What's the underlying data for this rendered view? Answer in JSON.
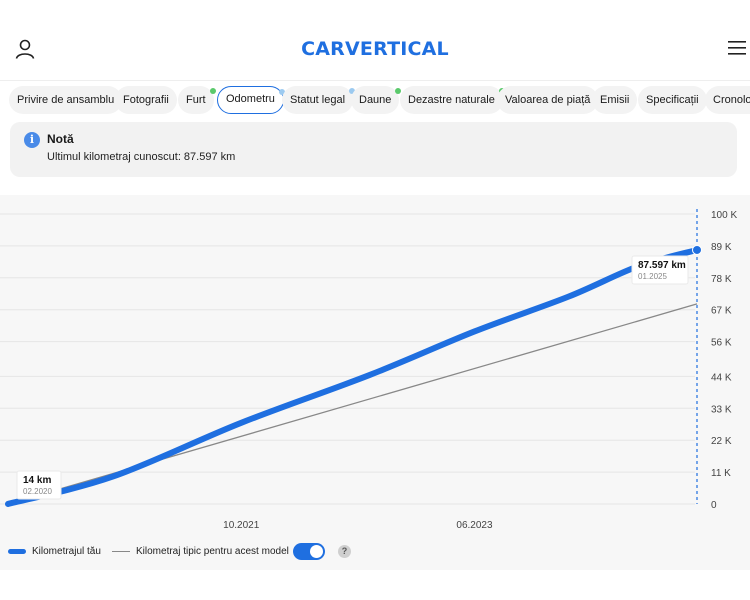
{
  "header": {
    "logo_text": "CARVERTICAL",
    "user_icon": "user-icon",
    "menu_icon": "hamburger-menu-icon"
  },
  "tabs": [
    {
      "label": "Privire de ansamblu",
      "active": false,
      "dot": null
    },
    {
      "label": "Fotografii",
      "active": false,
      "dot": null
    },
    {
      "label": "Furt",
      "active": false,
      "dot": "#5ac96b"
    },
    {
      "label": "Odometru",
      "active": true,
      "dot": "#9ccaf0"
    },
    {
      "label": "Statut legal",
      "active": false,
      "dot": "#9ccaf0"
    },
    {
      "label": "Daune",
      "active": false,
      "dot": "#5ac96b"
    },
    {
      "label": "Dezastre naturale",
      "active": false,
      "dot": "#5ac96b"
    },
    {
      "label": "Valoarea de piață",
      "active": false,
      "dot": null
    },
    {
      "label": "Emisii",
      "active": false,
      "dot": null
    },
    {
      "label": "Specificații",
      "active": false,
      "dot": null
    },
    {
      "label": "Cronologie",
      "active": false,
      "dot": null
    }
  ],
  "note": {
    "title": "Notă",
    "text": "Ultimul kilometraj cunoscut: 87.597 km"
  },
  "chart_data": {
    "type": "line",
    "y_ticks": [
      "100 K",
      "89 K",
      "78 K",
      "67 K",
      "56 K",
      "44 K",
      "33 K",
      "22 K",
      "11 K",
      "0"
    ],
    "y_tick_values": [
      100000,
      89000,
      78000,
      67000,
      56000,
      44000,
      33000,
      22000,
      11000,
      0
    ],
    "x_ticks": [
      "10.2021",
      "06.2023"
    ],
    "ylim": [
      0,
      100000
    ],
    "series": [
      {
        "name": "Kilometrajul tău",
        "color": "#1f6fe0",
        "points": [
          {
            "x": "2020-02",
            "y": 14
          },
          {
            "x": "2020-11",
            "y": 9500
          },
          {
            "x": "2021-10",
            "y": 28000
          },
          {
            "x": "2022-09",
            "y": 44500
          },
          {
            "x": "2023-06",
            "y": 59500
          },
          {
            "x": "2024-02",
            "y": 71500
          },
          {
            "x": "2024-08",
            "y": 82000
          },
          {
            "x": "2025-01",
            "y": 87597
          }
        ]
      },
      {
        "name": "Kilometraj tipic pentru acest model",
        "color": "#888888",
        "points": [
          {
            "x": "2020-02",
            "y": 0
          },
          {
            "x": "2025-01",
            "y": 69000
          }
        ]
      }
    ],
    "annotations": [
      {
        "value": "14 km",
        "date": "02.2020"
      },
      {
        "value": "87.597 km",
        "date": "01.2025"
      }
    ]
  },
  "legend": {
    "toggle_on": true,
    "help_symbol": "?"
  }
}
